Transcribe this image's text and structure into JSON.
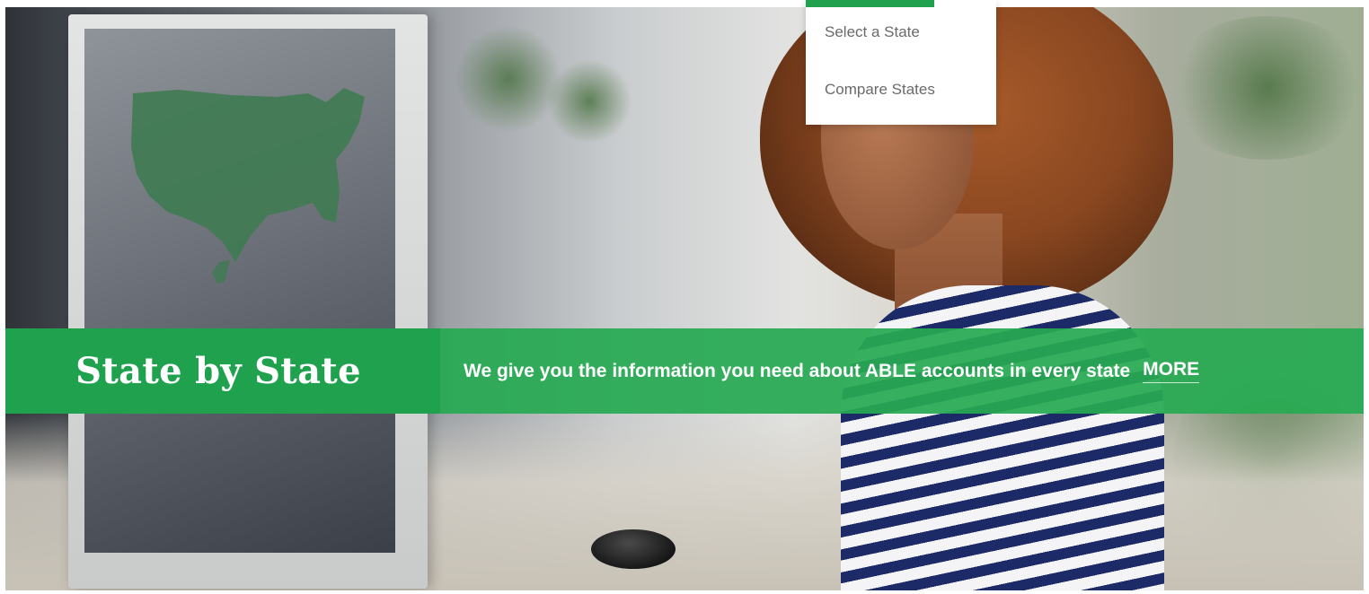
{
  "dropdown": {
    "items": [
      {
        "label": "Select a State"
      },
      {
        "label": "Compare States"
      }
    ]
  },
  "banner": {
    "title": "State by State",
    "description": "We give you the information you need about ABLE accounts in every state",
    "more_label": "MORE"
  },
  "colors": {
    "accent_green": "#20a14e",
    "banner_green": "#27aa52",
    "white": "#ffffff"
  }
}
